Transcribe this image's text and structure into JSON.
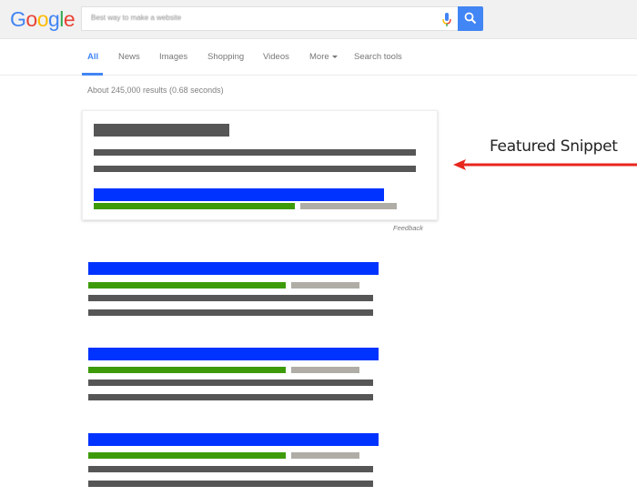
{
  "header": {
    "logo": {
      "letters": [
        {
          "char": "G",
          "color": "#4285f4"
        },
        {
          "char": "o",
          "color": "#ea4335"
        },
        {
          "char": "o",
          "color": "#fbbc05"
        },
        {
          "char": "g",
          "color": "#4285f4"
        },
        {
          "char": "l",
          "color": "#34a853"
        },
        {
          "char": "e",
          "color": "#ea4335"
        }
      ]
    },
    "search": {
      "query": "Best way to make a website",
      "mic_icon": "microphone-icon",
      "search_icon": "magnifier-icon"
    }
  },
  "tabs": [
    {
      "label": "All",
      "active": true
    },
    {
      "label": "News",
      "active": false
    },
    {
      "label": "Images",
      "active": false
    },
    {
      "label": "Shopping",
      "active": false
    },
    {
      "label": "Videos",
      "active": false
    },
    {
      "label": "More",
      "active": false,
      "has_dropdown": true
    },
    {
      "label": "Search tools",
      "active": false
    }
  ],
  "results_stats": "About 245,000 results (0.68 seconds)",
  "featured_snippet": {
    "feedback_label": "Feedback"
  },
  "annotation": {
    "label": "Featured Snippet",
    "arrow_color": "#e8261c"
  },
  "colors": {
    "link_placeholder": "#0033ff",
    "url_placeholder": "#3d9b0a",
    "meta_placeholder": "#b0ada6",
    "text_placeholder": "#565656",
    "accent": "#4285f4"
  },
  "results_count_shown": 3
}
